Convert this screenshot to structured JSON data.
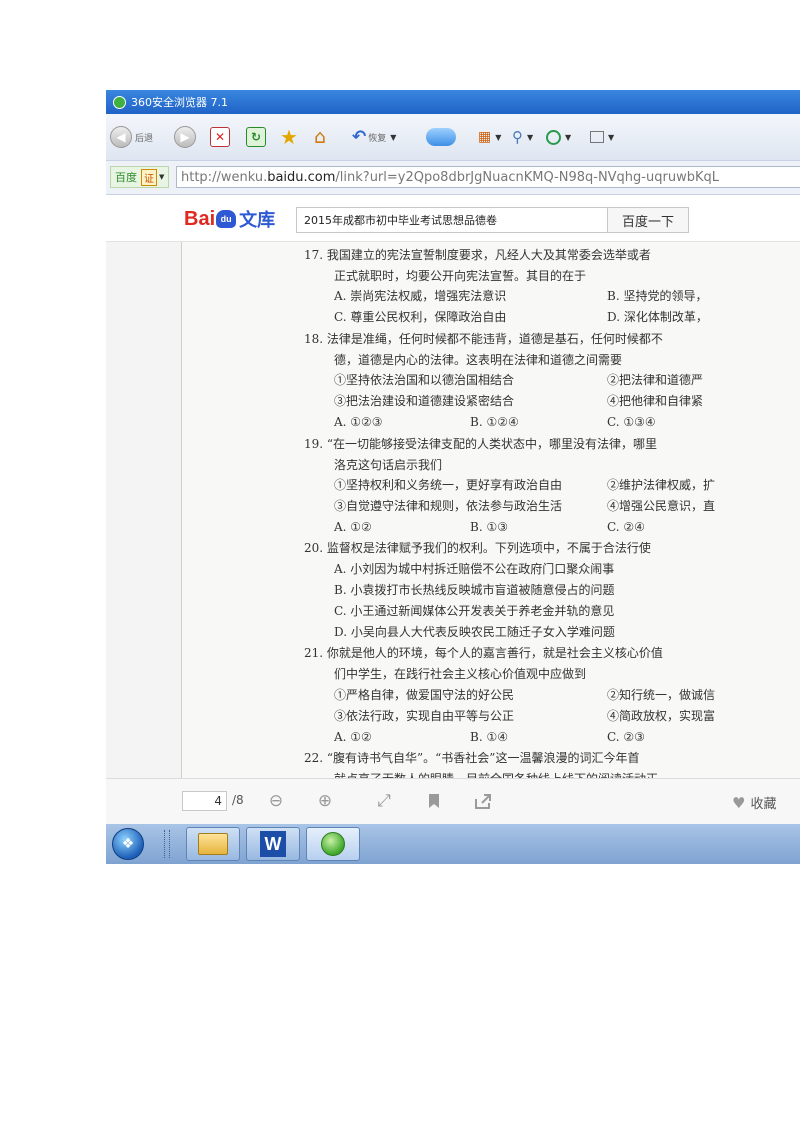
{
  "browser": {
    "title": "360安全浏览器 7.1",
    "back_label": "后退",
    "restore_label": "恢复",
    "address_prefix": "百度",
    "address_badge": "证",
    "url_start": "http://wenku.",
    "url_domain": "baidu.com",
    "url_rest": "/link?url=y2Qpo8dbrJgNuacnKMQ-N98q-NVqhg-uqruwbKqL"
  },
  "baidu": {
    "logo_left": "Bai",
    "logo_paw": "du",
    "logo_wenku": "文库",
    "search_value": "2015年成都市初中毕业考试思想品德卷",
    "search_button": "百度一下"
  },
  "document": {
    "lines": [
      "17. 我国建立的宪法宣誓制度要求，凡经人大及其常委会选举或者",
      "正式就职时，均要公开向宪法宣誓。其目的在于",
      "18. 法律是准绳，任何时候都不能违背，道德是基石，任何时候都不",
      "德，道德是内心的法律。这表明在法律和道德之间需要",
      "19. “在一切能够接受法律支配的人类状态中，哪里没有法律，哪里",
      "洛克这句话启示我们",
      "20. 监督权是法律赋予我们的权利。下列选项中，不属于合法行使",
      "A. 小刘因为城中村拆迁赔偿不公在政府门口聚众闹事",
      "B. 小袁拨打市长热线反映城市盲道被随意侵占的问题",
      "C. 小王通过新闻媒体公开发表关于养老金并轨的意见",
      "D. 小吴向县人大代表反映农民工随迁子女入学难问题",
      "21. 你就是他人的环境，每个人的嘉言善行，就是社会主义核心价值",
      "们中学生，在践行社会主义核心价值观中应做到",
      "22. “腹有诗书气自华”。“书香社会”这一温馨浪漫的词汇今年首",
      "就点亮了无数人的眼睛，目前全国各种线上线下的阅读活动正"
    ],
    "options": [
      "A. 崇尚宪法权威，增强宪法意识",
      "B. 坚持党的领导，",
      "C. 尊重公民权利，保障政治自由",
      "D. 深化体制改革，",
      "①坚持依法治国和以德治国相结合",
      "②把法律和道德严",
      "③把法治建设和道德建设紧密结合",
      "④把他律和自律紧",
      "A. ①②③",
      "B. ①②④",
      "C. ①③④",
      "①坚持权利和义务统一，更好享有政治自由",
      "②维护法律权威，扩",
      "③自觉遵守法律和规则，依法参与政治生活",
      "④增强公民意识，直",
      "A. ①②",
      "B. ①③",
      "C. ②④",
      "①严格自律，做爱国守法的好公民",
      "②知行统一，做诚信",
      "③依法行政，实现自由平等与公正",
      "④简政放权，实现富",
      "A. ①②",
      "B. ①④",
      "C. ②③"
    ]
  },
  "viewer": {
    "current_page": "4",
    "total_pages": "/8",
    "favorite_label": "收藏"
  },
  "colors": {
    "titlebar": "#1f63c6",
    "baidu_red": "#de2a20",
    "baidu_blue": "#2f58d4",
    "taskbar": "#7fa3d1"
  }
}
